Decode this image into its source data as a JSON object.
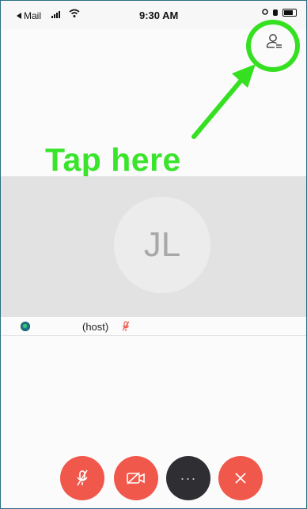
{
  "status_bar": {
    "back_app_label": "Mail",
    "time": "9:30 AM",
    "icons": [
      "signal-icon",
      "wifi-icon",
      "alarm-icon",
      "location-icon",
      "battery-icon"
    ]
  },
  "header": {
    "participants_icon": "participants-list-icon"
  },
  "annotation": {
    "text": "Tap here",
    "color": "#38e52a"
  },
  "video": {
    "avatar_initials": "JL"
  },
  "participant": {
    "host_label": "(host)",
    "mic_state": "muted"
  },
  "controls": {
    "buttons": [
      "mute-mic",
      "stop-video",
      "more",
      "leave-call"
    ],
    "accent_red": "#f0584b",
    "dark": "#2e2e33"
  }
}
